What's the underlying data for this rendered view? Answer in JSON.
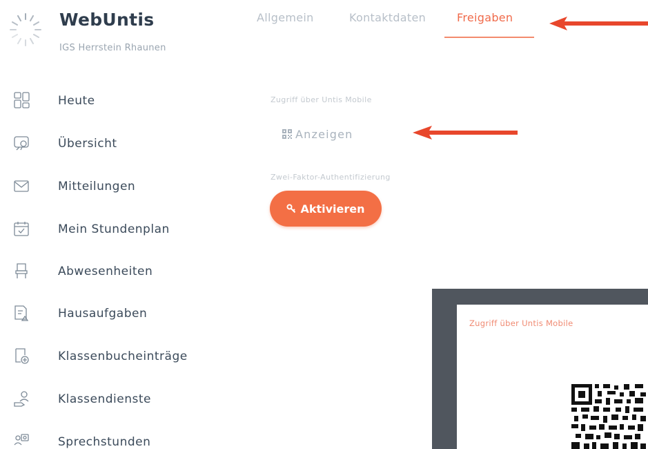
{
  "brand": {
    "title": "WebUntis",
    "subtitle": "IGS Herrstein Rhaunen",
    "logo_icon": "spinner-sun-icon"
  },
  "tabs": [
    {
      "label": "Allgemein",
      "active": false
    },
    {
      "label": "Kontaktdaten",
      "active": false
    },
    {
      "label": "Freigaben",
      "active": true
    }
  ],
  "sidebar": {
    "items": [
      {
        "label": "Heute",
        "icon": "dashboard-icon"
      },
      {
        "label": "Übersicht",
        "icon": "overview-icon"
      },
      {
        "label": "Mitteilungen",
        "icon": "envelope-icon"
      },
      {
        "label": "Mein Stundenplan",
        "icon": "calendar-icon"
      },
      {
        "label": "Abwesenheiten",
        "icon": "chair-icon"
      },
      {
        "label": "Hausaufgaben",
        "icon": "homework-icon"
      },
      {
        "label": "Klassenbucheinträge",
        "icon": "classbook-add-icon"
      },
      {
        "label": "Klassendienste",
        "icon": "class-duty-icon"
      },
      {
        "label": "Sprechstunden",
        "icon": "office-hours-icon"
      }
    ]
  },
  "freigaben": {
    "mobile_access_label": "Zugriff über Untis Mobile",
    "show_button_label": "Anzeigen",
    "two_factor_label": "Zwei-Faktor-Authentifizierung",
    "activate_button_label": "Aktivieren"
  },
  "dialog": {
    "title": "Zugriff über Untis Mobile"
  },
  "colors": {
    "accent": "#f36f45",
    "active_tab": "#f06a4a",
    "arrow": "#e8472c",
    "text_primary": "#3b4a5a",
    "text_muted": "#b7bfc8",
    "dialog_frame": "#50565e"
  }
}
